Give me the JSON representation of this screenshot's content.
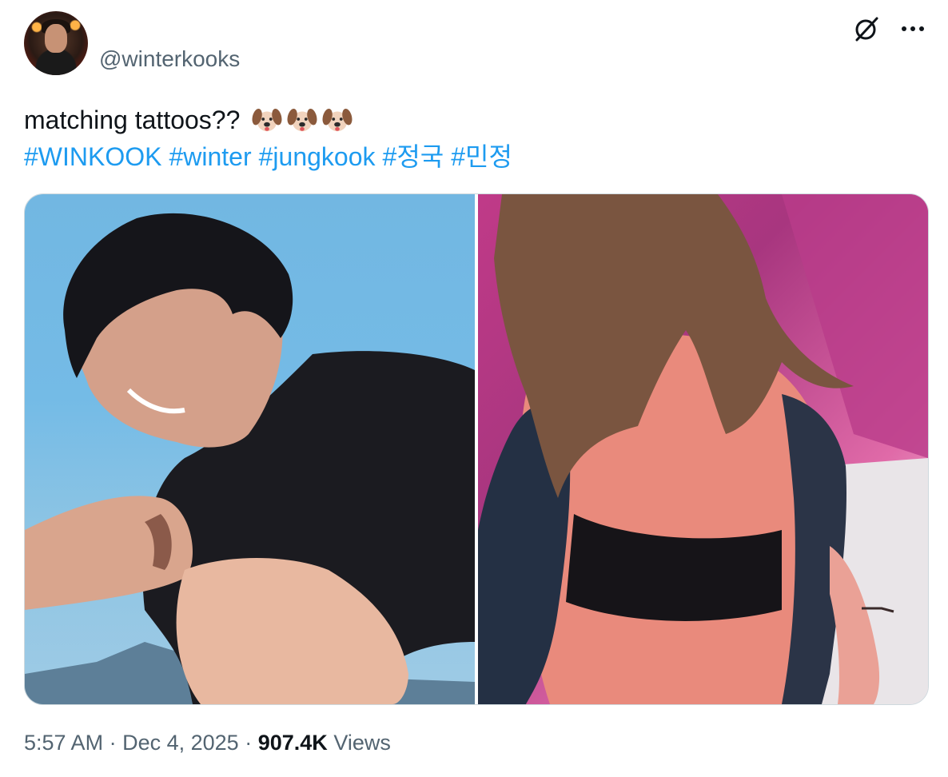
{
  "author": {
    "handle": "@winterkooks"
  },
  "post": {
    "text": "matching tattoos??",
    "emoji_name": "dog-face-emoji",
    "emoji_count": 3,
    "hashtags": [
      "#WINKOOK",
      "#winter",
      "#jungkook",
      "#정국",
      "#민정"
    ]
  },
  "header_icons": [
    "grok-icon",
    "more-options-icon"
  ],
  "meta": {
    "time": "5:57 AM",
    "sep1": "·",
    "date": "Dec 4, 2025",
    "sep2": "·",
    "views_count": "907.4K",
    "views_label": "Views"
  },
  "colors": {
    "link": "#1d9bf0",
    "secondary": "#536471",
    "text": "#0f1419"
  }
}
